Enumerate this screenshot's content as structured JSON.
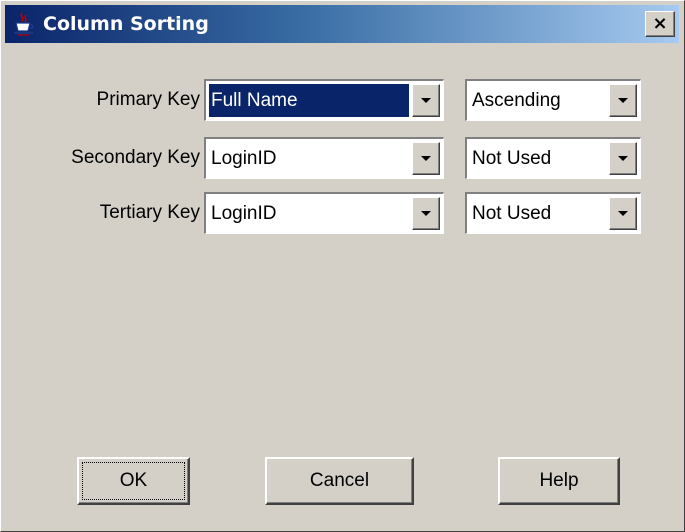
{
  "window": {
    "title": "Column Sorting",
    "close_glyph": "×",
    "icon": "java-cup-icon"
  },
  "rows": [
    {
      "label": "Primary Key",
      "key_value": "Full Name",
      "order_value": "Ascending",
      "key_selected": true
    },
    {
      "label": "Secondary Key",
      "key_value": "LoginID",
      "order_value": "Not Used",
      "key_selected": false
    },
    {
      "label": "Tertiary Key",
      "key_value": "LoginID",
      "order_value": "Not Used",
      "key_selected": false
    }
  ],
  "buttons": {
    "ok": "OK",
    "cancel": "Cancel",
    "help": "Help"
  },
  "colors": {
    "selection_bg": "#0a246a",
    "window_bg": "#d4d0c8",
    "titlebar_start": "#0a246a",
    "titlebar_end": "#a6caf0"
  }
}
